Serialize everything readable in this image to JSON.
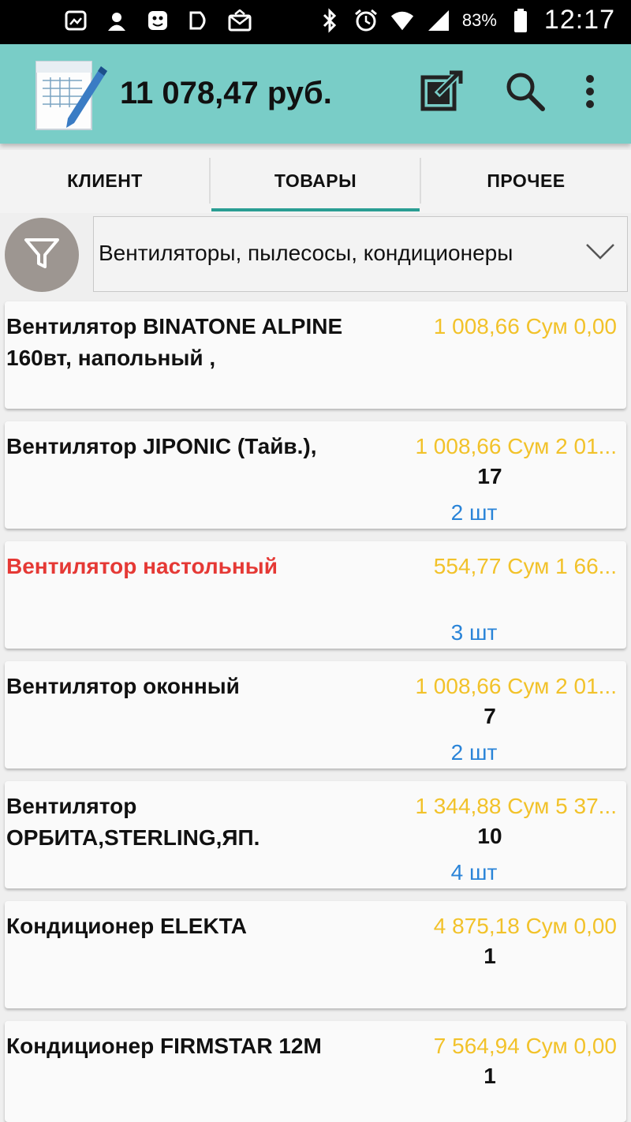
{
  "status_bar": {
    "battery": "83%",
    "time": "12:17"
  },
  "app_bar": {
    "title": "11 078,47 руб."
  },
  "tabs": [
    {
      "label": "КЛИЕНТ"
    },
    {
      "label": "ТОВАРЫ"
    },
    {
      "label": "ПРОЧЕЕ"
    }
  ],
  "active_tab": "ТОВАРЫ",
  "filter": {
    "category": "Вентиляторы, пылесосы, кондиционеры"
  },
  "products": [
    {
      "name": "Вентилятор BINATONE ALPINE 160вт, напольный ,",
      "price": "1 008,66 Сум 0,00",
      "stock": "",
      "qty": ""
    },
    {
      "name": "Вентилятор JIPONIC (Тайв.),",
      "price": "1 008,66 Сум 2 01...",
      "stock": "17",
      "qty": "2 шт"
    },
    {
      "name": "Вентилятор настольный",
      "price": "554,77 Сум 1 66...",
      "stock": "",
      "qty": "3 шт"
    },
    {
      "name": "Вентилятор оконный",
      "price": "1 008,66 Сум 2 01...",
      "stock": "7",
      "qty": "2 шт"
    },
    {
      "name": "Вентилятор ОРБИТА,STERLING,ЯП.",
      "price": "1 344,88 Сум 5 37...",
      "stock": "10",
      "qty": "4 шт"
    },
    {
      "name": "Кондиционер ELEKTA",
      "price": "4 875,18 Сум 0,00",
      "stock": "1",
      "qty": ""
    },
    {
      "name": "Кондиционер FIRMSTAR 12M",
      "price": "7 564,94 Сум 0,00",
      "stock": "1",
      "qty": ""
    }
  ],
  "colors": {
    "app_bar": "#79cdc7",
    "tab_indicator": "#2a9d93",
    "price": "#f2c22a",
    "quantity": "#2a84d8",
    "highlight_name": "#e53935"
  }
}
